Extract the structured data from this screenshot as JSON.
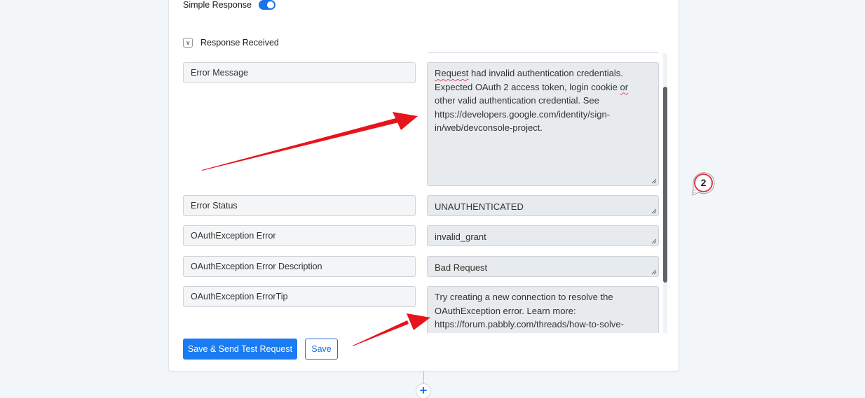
{
  "simple_response": {
    "label": "Simple Response",
    "enabled": true
  },
  "response_received": {
    "label": "Response Received"
  },
  "rows": [
    {
      "key": "Error Message",
      "value_parts": [
        "Request",
        " had invalid authentication credentials. Expected OAuth 2 access token, login cookie ",
        "or",
        " other valid authentication credential. See https://developers.google.com/identity/sign-in/web/devconsole-project."
      ]
    },
    {
      "key": "Error Status",
      "value": "UNAUTHENTICATED"
    },
    {
      "key": "OAuthException Error",
      "value": "invalid_grant"
    },
    {
      "key": "OAuthException Error Description",
      "value": "Bad Request"
    },
    {
      "key": "OAuthException ErrorTip",
      "value": "Try creating a new connection to resolve the OAuthException error. Learn more: https://forum.pabbly.com/threads/how-to-solve-"
    }
  ],
  "buttons": {
    "save_send": "Save & Send Test Request",
    "save": "Save"
  },
  "step_number": "2",
  "add_icon": "+",
  "colors": {
    "primary": "#1a7bf2",
    "annotation_arrow": "#e8141b",
    "badge_ring": "#e0354a"
  }
}
